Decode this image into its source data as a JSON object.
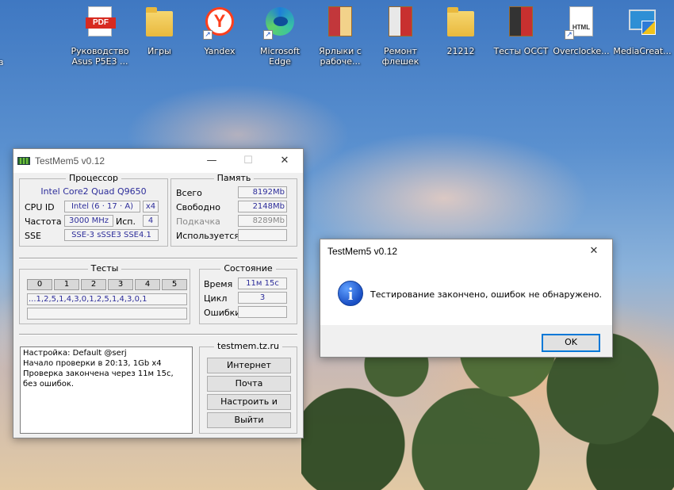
{
  "desktop": {
    "left_edge_label": "в",
    "icons": [
      {
        "label": "Руководство Asus P5E3 ...",
        "icon": "pdf-icon",
        "icon_text": "PDF"
      },
      {
        "label": "Игры",
        "icon": "folder-icon"
      },
      {
        "label": "Yandex",
        "icon": "yandex-icon",
        "icon_text": "Y"
      },
      {
        "label": "Microsoft Edge",
        "icon": "edge-icon"
      },
      {
        "label": "Ярлыки с рабочe...",
        "icon": "folder-icon"
      },
      {
        "label": "Ремонт флешек",
        "icon": "book-folder-icon"
      },
      {
        "label": "21212",
        "icon": "folder-icon"
      },
      {
        "label": "Тесты ОССТ",
        "icon": "book-folder-icon"
      },
      {
        "label": "Overclocke...",
        "icon": "html-icon",
        "icon_text": "HTML"
      },
      {
        "label": "MediaCreat...",
        "icon": "media-creation-icon"
      }
    ]
  },
  "testmem": {
    "title": "TestMem5 v0.12",
    "processor": {
      "group_title": "Процессор",
      "cpu_name": "Intel Core2 Quad  Q9650",
      "cpuid_label": "CPU ID",
      "cpuid_value": "Intel  (6 · 17 · A)",
      "cores_value": "x4",
      "freq_label": "Частота",
      "freq_value": "3000 MHz",
      "used_label": "Исп.",
      "used_value": "4",
      "sse_label": "SSE",
      "sse_value": "SSE-3 sSSE3 SSE4.1"
    },
    "memory": {
      "group_title": "Память",
      "total_label": "Всего",
      "total_value": "8192Mb",
      "free_label": "Свободно",
      "free_value": "2148Mb",
      "swap_label": "Подкачка",
      "swap_value": "8289Mb",
      "used_label": "Используется",
      "used_value": ""
    },
    "tests": {
      "group_title": "Тесты",
      "cells": [
        "0",
        "1",
        "2",
        "3",
        "4",
        "5"
      ],
      "sequence": "...1,2,5,1,4,3,0,1,2,5,1,4,3,0,1"
    },
    "status": {
      "group_title": "Состояние",
      "time_label": "Время",
      "time_value": "11м 15с",
      "cycle_label": "Цикл",
      "cycle_value": "3",
      "errors_label": "Ошибки",
      "errors_value": ""
    },
    "log": "Настройка: Default @serj\nНачало проверки в 20:13, 1Gb x4\nПроверка закончена через 11м 15с,\nбез ошибок.",
    "links": {
      "group_title": "testmem.tz.ru",
      "internet": "Интернет",
      "mail": "Почта",
      "configure": "Настроить и выйти",
      "exit": "Выйти"
    }
  },
  "dialog": {
    "title": "TestMem5 v0.12",
    "message": "Тестирование закончено, ошибок не обнаружено.",
    "ok": "OK"
  }
}
